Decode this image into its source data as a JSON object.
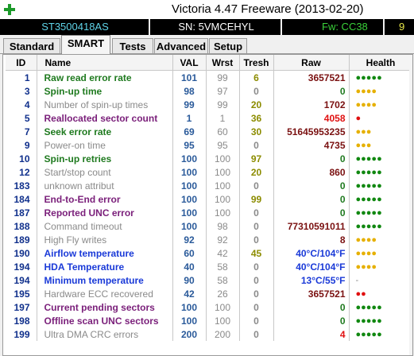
{
  "window": {
    "title": "Victoria 4.47  Freeware (2013-02-20)"
  },
  "info": {
    "model": "ST3500418AS",
    "serial": "SN: 5VMCEHYL",
    "firmware": "Fw: CC38",
    "extra": "9"
  },
  "tabs": [
    {
      "label": "Standard"
    },
    {
      "label": "SMART"
    },
    {
      "label": "Tests"
    },
    {
      "label": "Advanced"
    },
    {
      "label": "Setup"
    }
  ],
  "table": {
    "headers": {
      "id": "ID",
      "name": "Name",
      "val": "VAL",
      "wrst": "Wrst",
      "thresh": "Tresh",
      "raw": "Raw",
      "health": "Health"
    },
    "rows": [
      {
        "id": "1",
        "name": "Raw read error rate",
        "val": "101",
        "wrst": "99",
        "thresh": "6",
        "raw": "3657521",
        "health": "●●●●●",
        "name_color": "green",
        "raw_color": "dark",
        "health_color": "green",
        "hl": true
      },
      {
        "id": "3",
        "name": "Spin-up time",
        "val": "98",
        "wrst": "97",
        "thresh": "0",
        "raw": "0",
        "health": "●●●●",
        "name_color": "green",
        "raw_color": "green",
        "health_color": "yellow",
        "hl": false
      },
      {
        "id": "4",
        "name": "Number of spin-up times",
        "val": "99",
        "wrst": "99",
        "thresh": "20",
        "raw": "1702",
        "health": "●●●●",
        "name_color": "gray",
        "raw_color": "dark",
        "health_color": "yellow",
        "hl": true
      },
      {
        "id": "5",
        "name": "Reallocated sector count",
        "val": "1",
        "wrst": "1",
        "thresh": "36",
        "raw": "4058",
        "health": "●",
        "name_color": "purple",
        "raw_color": "red",
        "health_color": "red",
        "hl": true
      },
      {
        "id": "7",
        "name": "Seek error rate",
        "val": "69",
        "wrst": "60",
        "thresh": "30",
        "raw": "51645953235",
        "health": "●●●",
        "name_color": "green",
        "raw_color": "dark",
        "health_color": "yellow",
        "hl": true
      },
      {
        "id": "9",
        "name": "Power-on time",
        "val": "95",
        "wrst": "95",
        "thresh": "0",
        "raw": "4735",
        "health": "●●●",
        "name_color": "gray",
        "raw_color": "dark",
        "health_color": "yellow",
        "hl": false
      },
      {
        "id": "10",
        "name": "Spin-up retries",
        "val": "100",
        "wrst": "100",
        "thresh": "97",
        "raw": "0",
        "health": "●●●●●",
        "name_color": "green",
        "raw_color": "green",
        "health_color": "green",
        "hl": true
      },
      {
        "id": "12",
        "name": "Start/stop count",
        "val": "100",
        "wrst": "100",
        "thresh": "20",
        "raw": "860",
        "health": "●●●●●",
        "name_color": "gray",
        "raw_color": "dark",
        "health_color": "green",
        "hl": true
      },
      {
        "id": "183",
        "name": "unknown attribut",
        "val": "100",
        "wrst": "100",
        "thresh": "0",
        "raw": "0",
        "health": "●●●●●",
        "name_color": "gray",
        "raw_color": "green",
        "health_color": "green",
        "hl": false
      },
      {
        "id": "184",
        "name": "End-to-End error",
        "val": "100",
        "wrst": "100",
        "thresh": "99",
        "raw": "0",
        "health": "●●●●●",
        "name_color": "purple",
        "raw_color": "green",
        "health_color": "green",
        "hl": true
      },
      {
        "id": "187",
        "name": "Reported UNC error",
        "val": "100",
        "wrst": "100",
        "thresh": "0",
        "raw": "0",
        "health": "●●●●●",
        "name_color": "purple",
        "raw_color": "green",
        "health_color": "green",
        "hl": false
      },
      {
        "id": "188",
        "name": "Command timeout",
        "val": "100",
        "wrst": "98",
        "thresh": "0",
        "raw": "77310591011",
        "health": "●●●●●",
        "name_color": "gray",
        "raw_color": "dark",
        "health_color": "green",
        "hl": false
      },
      {
        "id": "189",
        "name": "High Fly writes",
        "val": "92",
        "wrst": "92",
        "thresh": "0",
        "raw": "8",
        "health": "●●●●",
        "name_color": "gray",
        "raw_color": "dark",
        "health_color": "yellow",
        "hl": false
      },
      {
        "id": "190",
        "name": "Airflow temperature",
        "val": "60",
        "wrst": "42",
        "thresh": "45",
        "raw": "40°C/104°F",
        "health": "●●●●",
        "name_color": "blue",
        "raw_color": "blue",
        "health_color": "yellow",
        "hl": true
      },
      {
        "id": "194",
        "name": "HDA Temperature",
        "val": "40",
        "wrst": "58",
        "thresh": "0",
        "raw": "40°C/104°F",
        "health": "●●●●",
        "name_color": "blue",
        "raw_color": "blue",
        "health_color": "yellow",
        "hl": false
      },
      {
        "id": "194",
        "name": "Minimum temperature",
        "val": "90",
        "wrst": "58",
        "thresh": "0",
        "raw": "13°C/55°F",
        "health": "-",
        "name_color": "blue",
        "raw_color": "blue",
        "health_color": "gray",
        "hl": false
      },
      {
        "id": "195",
        "name": "Hardware ECC recovered",
        "val": "42",
        "wrst": "26",
        "thresh": "0",
        "raw": "3657521",
        "health": "●●",
        "name_color": "gray",
        "raw_color": "dark",
        "health_color": "red",
        "hl": false
      },
      {
        "id": "197",
        "name": "Current pending sectors",
        "val": "100",
        "wrst": "100",
        "thresh": "0",
        "raw": "0",
        "health": "●●●●●",
        "name_color": "purple",
        "raw_color": "green",
        "health_color": "green",
        "hl": false
      },
      {
        "id": "198",
        "name": "Offline scan UNC sectors",
        "val": "100",
        "wrst": "100",
        "thresh": "0",
        "raw": "0",
        "health": "●●●●●",
        "name_color": "purple",
        "raw_color": "green",
        "health_color": "green",
        "hl": false
      },
      {
        "id": "199",
        "name": "Ultra DMA CRC errors",
        "val": "200",
        "wrst": "200",
        "thresh": "0",
        "raw": "4",
        "health": "●●●●●",
        "name_color": "gray",
        "raw_color": "red",
        "health_color": "green",
        "hl": false
      }
    ]
  }
}
